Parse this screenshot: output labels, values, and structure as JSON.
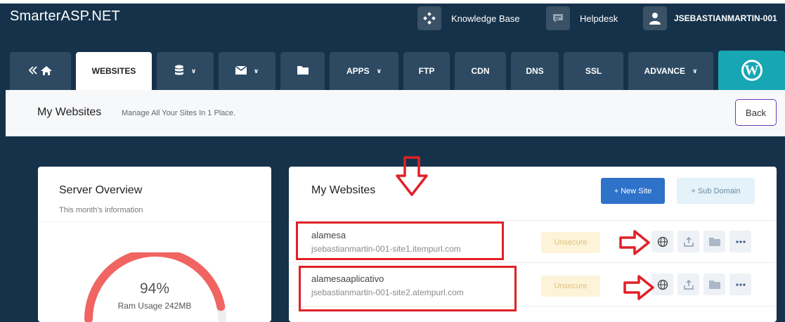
{
  "header": {
    "brand": "SmarterASP.NET",
    "knowledge_base": "Knowledge Base",
    "helpdesk": "Helpdesk",
    "username": "JSEBASTIANMARTIN-001"
  },
  "nav": {
    "tabs": [
      {
        "label": "",
        "icon": "back-home-icon"
      },
      {
        "label": "WEBSITES",
        "active": true
      },
      {
        "label": "",
        "icon": "database-icon",
        "dropdown": true
      },
      {
        "label": "",
        "icon": "envelope-icon",
        "dropdown": true
      },
      {
        "label": "",
        "icon": "folder-icon"
      },
      {
        "label": "APPS",
        "dropdown": true
      },
      {
        "label": "FTP"
      },
      {
        "label": "CDN"
      },
      {
        "label": "DNS"
      },
      {
        "label": "SSL"
      },
      {
        "label": "ADVANCE",
        "dropdown": true
      },
      {
        "label": "",
        "icon": "wordpress-icon"
      }
    ],
    "wp_letter": "W"
  },
  "page": {
    "title": "My Websites",
    "subtitle": "Manage All Your Sites In 1 Place.",
    "back_label": "Back"
  },
  "server_overview": {
    "title": "Server Overview",
    "subtitle": "This month's information",
    "ram_percent": "94%",
    "ram_fraction": 0.94,
    "ram_label": "Ram Usage 242MB"
  },
  "websites": {
    "title": "My Websites",
    "new_site_label": "+ New Site",
    "sub_domain_label": "+ Sub Domain",
    "sites": [
      {
        "name": "alamesa",
        "url": "jsebastianmartin-001-site1.itempurl.com",
        "status": "Unsecure"
      },
      {
        "name": "alamesaaplicativo",
        "url": "jsebastianmartin-001-site2.atempurl.com",
        "status": "Unsecure"
      }
    ],
    "row_actions": [
      "globe-icon",
      "upload-icon",
      "folder-icon",
      "more-icon"
    ]
  },
  "colors": {
    "header_bg": "#15324a",
    "tab_bg": "#2d4a62",
    "wordpress_tab": "#17a7b4",
    "primary_button": "#2e72c9",
    "gauge": "#f06461",
    "annotation_red": "#e12027"
  }
}
